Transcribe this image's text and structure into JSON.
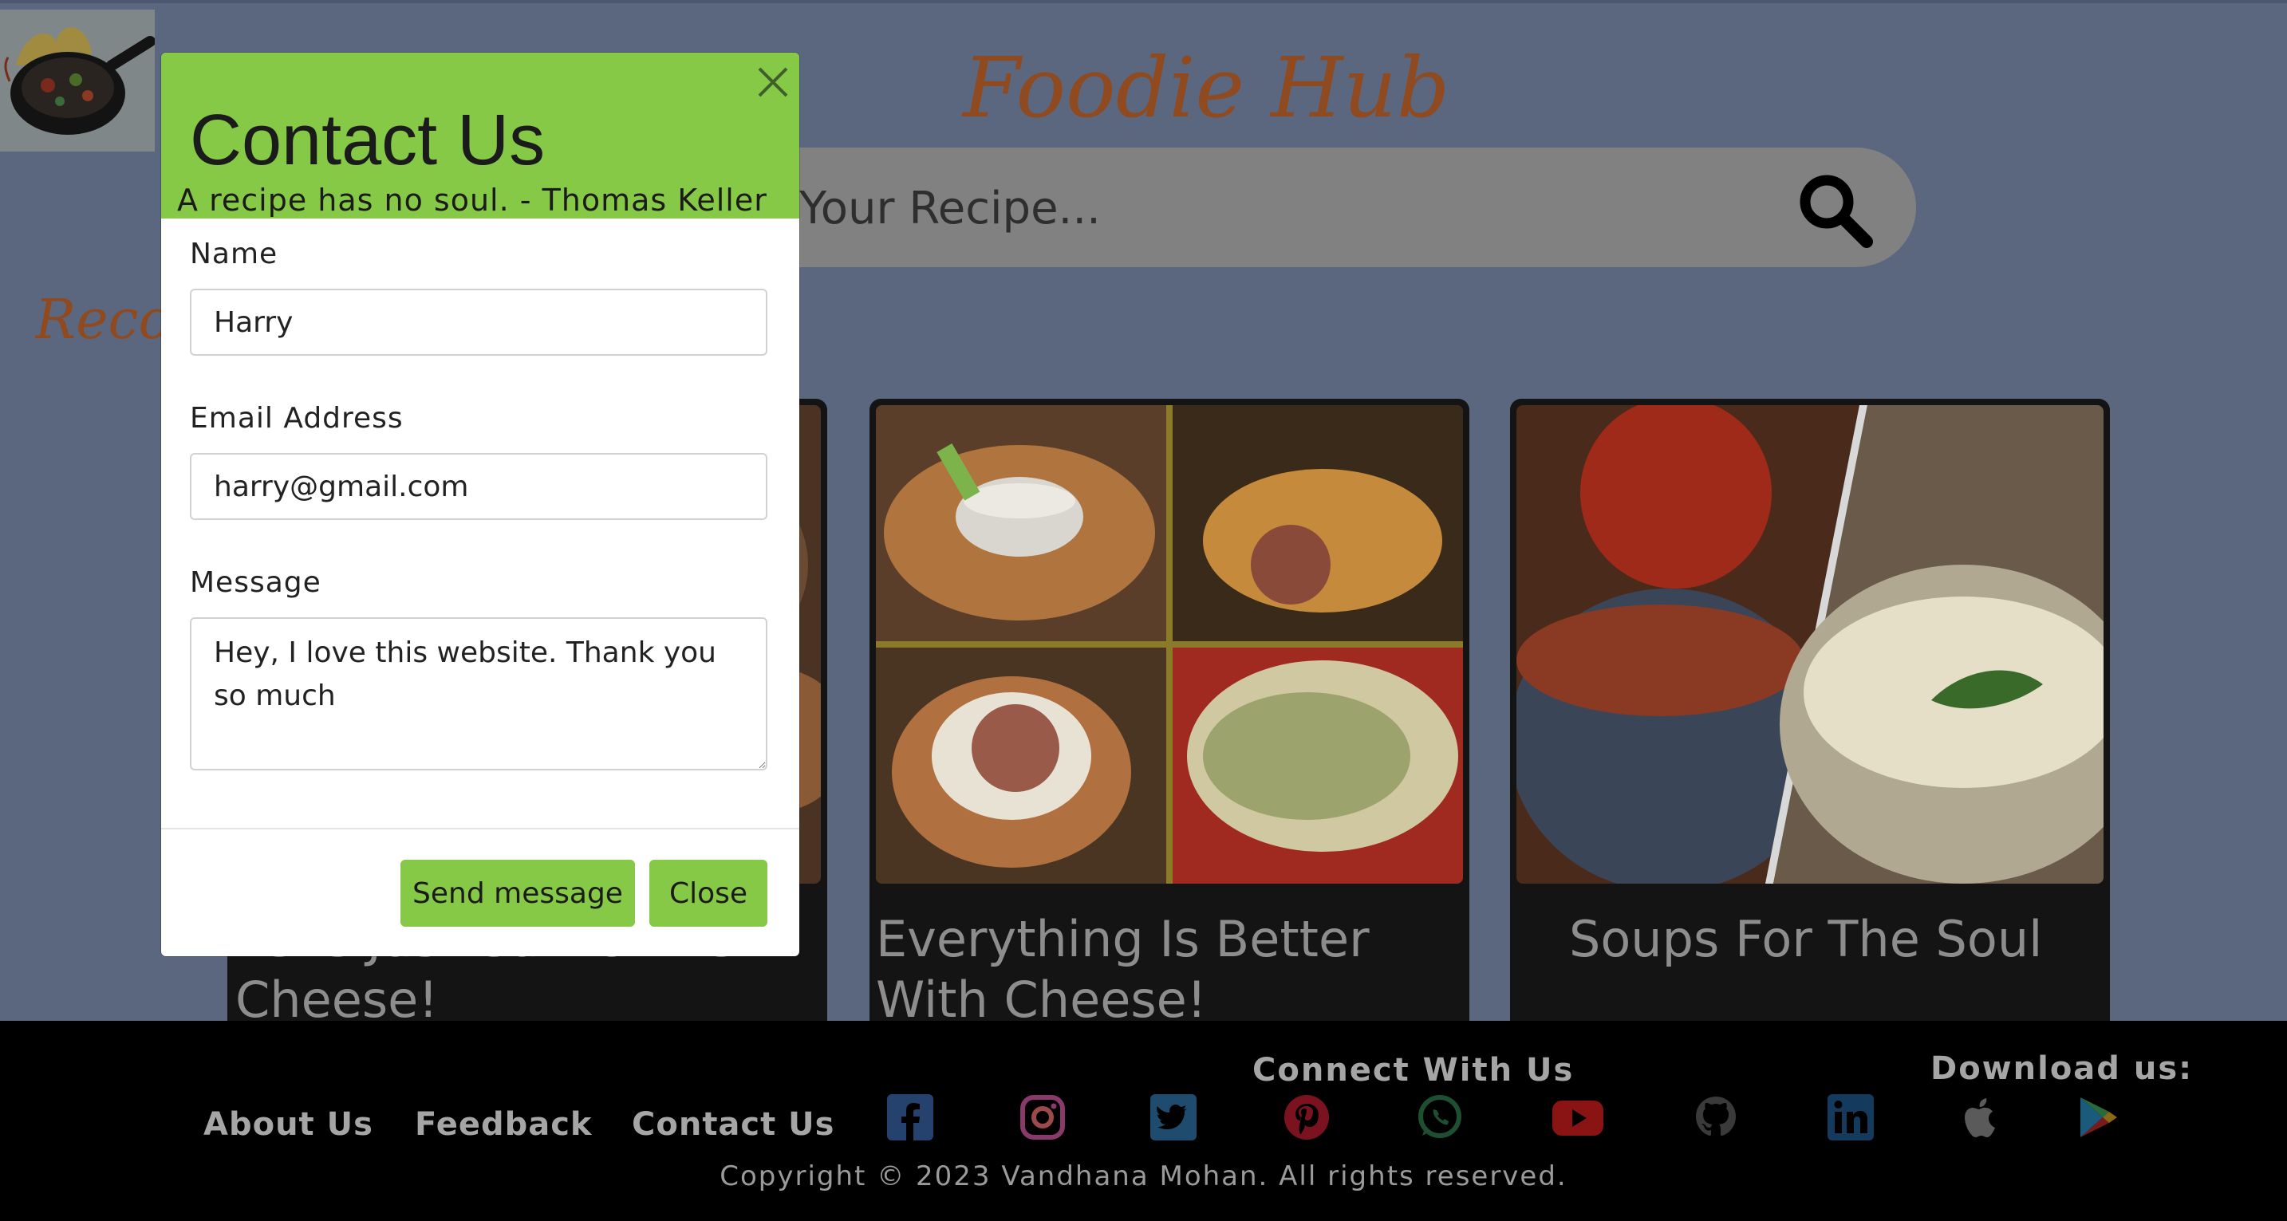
{
  "site": {
    "title": "Foodie Hub",
    "search_placeholder": "Your Recipe...",
    "section_heading": "Recommended"
  },
  "cards": [
    {
      "title": "Let's Just Cut To The Cheese!"
    },
    {
      "title": "Everything Is Better With Cheese!"
    },
    {
      "title": "Soups For The Soul"
    }
  ],
  "modal": {
    "title": "Contact Us",
    "quote": "A recipe has no soul. - Thomas Keller",
    "name_label": "Name",
    "name_value": "Harry",
    "email_label": "Email Address",
    "email_value": "harry@gmail.com",
    "message_label": "Message",
    "message_value": "Hey, I love this website. Thank you so much",
    "send_label": "Send message",
    "close_label": "Close"
  },
  "footer": {
    "links": [
      "About Us",
      "Feedback",
      "Contact Us"
    ],
    "connect_heading": "Connect With Us",
    "download_heading": "Download us:",
    "social_icons": [
      "facebook-icon",
      "instagram-icon",
      "twitter-icon",
      "pinterest-icon",
      "whatsapp-icon",
      "youtube-icon",
      "github-icon",
      "linkedin-icon"
    ],
    "download_icons": [
      "apple-icon",
      "google-play-icon"
    ],
    "copyright": "Copyright © 2023 Vandhana Mohan. All rights reserved."
  },
  "colors": {
    "backdrop": "#5b677f",
    "title_orange": "#8f4a20",
    "accent_green": "#86c946",
    "footer_bg": "#000000",
    "card_bg": "#141414"
  }
}
